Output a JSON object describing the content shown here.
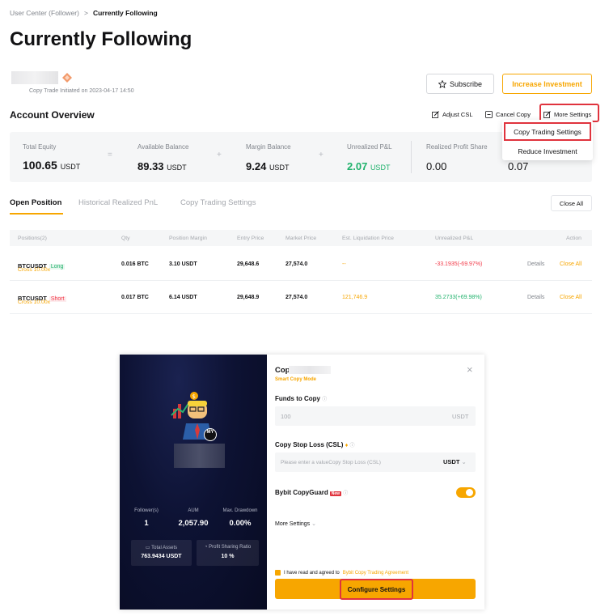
{
  "breadcrumb": {
    "parent": "User Center (Follower)",
    "separator": ">",
    "current": "Currently Following"
  },
  "page_title": "Currently Following",
  "trader": {
    "copy_initiated": "Copy Trade Initiated on 2023-04-17 14:50"
  },
  "header_buttons": {
    "subscribe": "Subscribe",
    "increase_investment": "Increase Investment"
  },
  "account_overview": {
    "title": "Account Overview",
    "actions": {
      "adjust_csl": "Adjust CSL",
      "cancel_copy": "Cancel Copy",
      "more_settings": "More Settings"
    },
    "dropdown": [
      "Copy Trading Settings",
      "Reduce Investment"
    ],
    "operators": {
      "eq": "=",
      "plus": "+"
    },
    "metrics": {
      "total_equity": {
        "label": "Total Equity",
        "value": "100.65",
        "unit": "USDT"
      },
      "available_balance": {
        "label": "Available Balance",
        "value": "89.33",
        "unit": "USDT"
      },
      "margin_balance": {
        "label": "Margin Balance",
        "value": "9.24",
        "unit": "USDT"
      },
      "unrealized_pnl": {
        "label": "Unrealized P&L",
        "value": "2.07",
        "unit": "USDT"
      },
      "realized_profit_share": {
        "label": "Realized Profit Share",
        "value": "0.00"
      },
      "extra": {
        "value": "0.07"
      }
    }
  },
  "tabs": [
    "Open Position",
    "Historical Realized PnL",
    "Copy Trading Settings"
  ],
  "close_all_button": "Close All",
  "table": {
    "headers": [
      "Positions(2)",
      "Qty",
      "Position Margin",
      "Entry Price",
      "Market Price",
      "Est. Liquidation Price",
      "Unrealized P&L",
      "Action"
    ],
    "rows": [
      {
        "symbol": "BTCUSDT",
        "side": "Long",
        "leverage": "Cross 10.00x",
        "qty": "0.016 BTC",
        "margin": "3.10 USDT",
        "entry": "29,648.6",
        "market": "27,574.0",
        "liq": "--",
        "pnl": "-33.1935(-69.97%)",
        "details": "Details",
        "close": "Close All"
      },
      {
        "symbol": "BTCUSDT",
        "side": "Short",
        "leverage": "Cross 10.00x",
        "qty": "0.017 BTC",
        "margin": "6.14 USDT",
        "entry": "29,648.9",
        "market": "27,574.0",
        "liq": "121,746.9",
        "pnl": "35.2733(+69.98%)",
        "details": "Details",
        "close": "Close All"
      }
    ]
  },
  "modal": {
    "left": {
      "avatar_badge": "MY",
      "stats": [
        {
          "label": "Follower(s)",
          "value": "1"
        },
        {
          "label": "AUM",
          "value": "2,057.90"
        },
        {
          "label": "Max. Drawdown",
          "value": "0.00%"
        }
      ],
      "total_assets": {
        "label": "Total Assets",
        "value": "763.9434 USDT"
      },
      "profit_sharing": {
        "label": "Profit Sharing Ratio",
        "value": "10 %"
      }
    },
    "title_prefix": "Cop",
    "subtitle": "Smart Copy Mode",
    "close_icon": "×",
    "funds_label": "Funds to Copy",
    "funds_value": "100",
    "funds_unit": "USDT",
    "csl_label": "Copy Stop Loss (CSL)",
    "csl_placeholder": "Please enter a valueCopy Stop Loss (CSL)",
    "csl_unit": "USDT",
    "copyguard_label": "Bybit CopyGuard",
    "new_badge": "New",
    "more_settings": "More Settings",
    "agree_text": "I have read and agreed to",
    "agree_link": "Bybit Copy Trading Agreement",
    "configure_button": "Configure Settings"
  }
}
